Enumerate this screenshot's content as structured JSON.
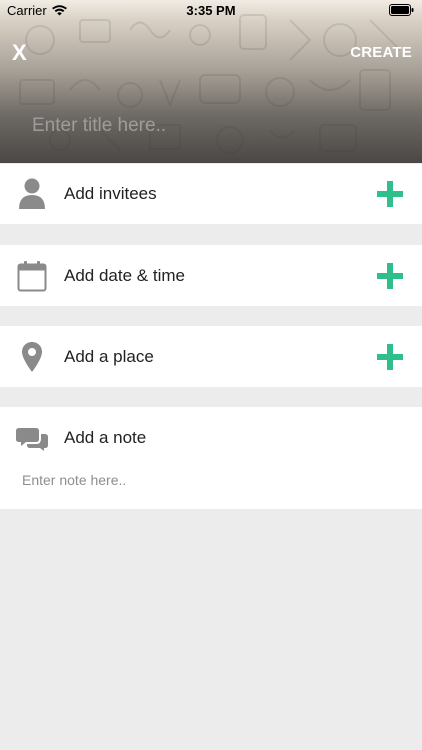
{
  "status_bar": {
    "carrier": "Carrier",
    "time": "3:35 PM"
  },
  "header": {
    "close_label": "X",
    "create_label": "CREATE",
    "title_placeholder": "Enter title here.."
  },
  "rows": {
    "invitees": {
      "label": "Add invitees",
      "icon": "person-icon"
    },
    "datetime": {
      "label": "Add date & time",
      "icon": "calendar-icon"
    },
    "place": {
      "label": "Add a place",
      "icon": "location-pin-icon"
    },
    "note": {
      "label": "Add a note",
      "icon": "chat-bubbles-icon",
      "placeholder": "Enter note here.."
    }
  },
  "colors": {
    "accent_plus": "#2fbf8a",
    "icon_gray": "#8a8a8a",
    "background": "#ececec"
  }
}
